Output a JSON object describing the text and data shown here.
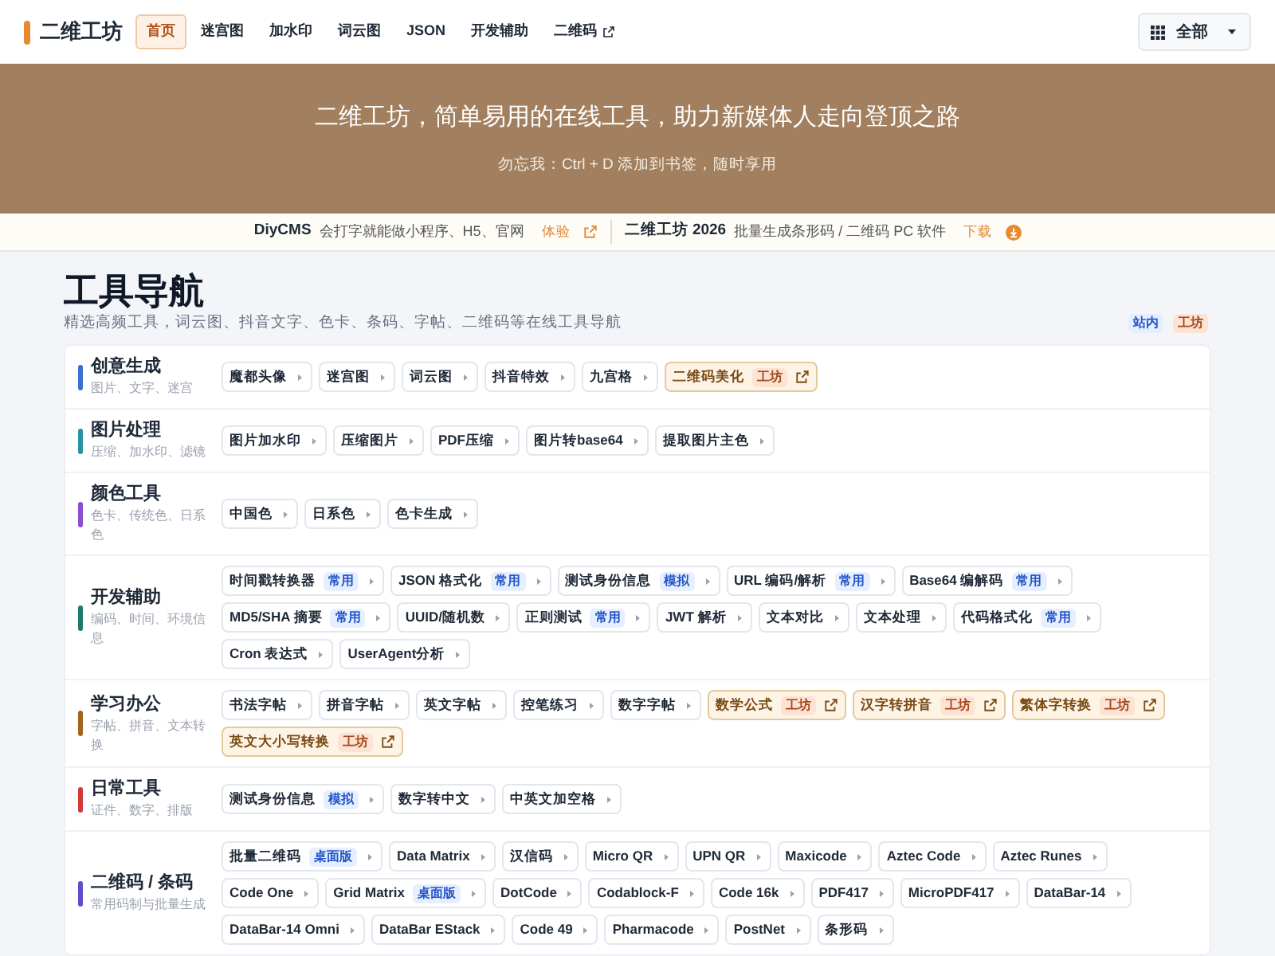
{
  "header": {
    "logo": "二维工坊",
    "nav": [
      {
        "label": "首页",
        "selected": true,
        "external": false
      },
      {
        "label": "迷宫图",
        "selected": false,
        "external": false
      },
      {
        "label": "加水印",
        "selected": false,
        "external": false
      },
      {
        "label": "词云图",
        "selected": false,
        "external": false
      },
      {
        "label": "JSON",
        "selected": false,
        "external": false
      },
      {
        "label": "开发辅助",
        "selected": false,
        "external": false
      },
      {
        "label": "二维码",
        "selected": false,
        "external": true
      }
    ],
    "menu": "全部"
  },
  "banner": {
    "title": "二维工坊，简单易用的在线工具，助力新媒体人走向登顶之路",
    "subtitle": "勿忘我：Ctrl + D 添加到书签，随时享用"
  },
  "promos": [
    {
      "name": "DiyCMS",
      "text": "会打字就能做小程序、H5、官网",
      "action": "体验",
      "kind": "external"
    },
    {
      "name": "二维工坊 2026",
      "text": "批量生成条形码 / 二维码 PC 软件",
      "action": "下载",
      "kind": "download"
    }
  ],
  "page": {
    "title": "工具导航",
    "subtitle": "精选高频工具，词云图、抖音文字、色卡、条码、字帖、二维码等在线工具导航",
    "legend": [
      {
        "text": "站内",
        "kind": "tag"
      },
      {
        "text": "工坊",
        "kind": "workshop"
      }
    ]
  },
  "sections": [
    {
      "title": "创意生成",
      "subtitle": "图片、文字、迷宫",
      "color": "#3b6fd4",
      "tools": [
        {
          "label": "魔都头像",
          "external": false
        },
        {
          "label": "迷宫图",
          "external": false
        },
        {
          "label": "词云图",
          "external": false
        },
        {
          "label": "抖音特效",
          "external": false
        },
        {
          "label": "九宫格",
          "external": false
        },
        {
          "label": "二维码美化",
          "external": true,
          "badge": {
            "text": "工坊",
            "kind": "workshop"
          }
        }
      ]
    },
    {
      "title": "图片处理",
      "subtitle": "压缩、加水印、滤镜",
      "color": "#2a93a3",
      "tools": [
        {
          "label": "图片加水印",
          "external": false
        },
        {
          "label": "压缩图片",
          "external": false
        },
        {
          "label": "PDF压缩",
          "external": false
        },
        {
          "label": "图片转base64",
          "external": false
        },
        {
          "label": "提取图片主色",
          "external": false
        }
      ]
    },
    {
      "title": "颜色工具",
      "subtitle": "色卡、传统色、日系色",
      "color": "#8b4fd6",
      "tools": [
        {
          "label": "中国色",
          "external": false
        },
        {
          "label": "日系色",
          "external": false
        },
        {
          "label": "色卡生成",
          "external": false
        }
      ]
    },
    {
      "title": "开发辅助",
      "subtitle": "编码、时间、环境信息",
      "color": "#1f7a6a",
      "tools": [
        {
          "label": "时间戳转换器",
          "external": false,
          "badge": {
            "text": "常用",
            "kind": "tag"
          }
        },
        {
          "label": "JSON 格式化",
          "external": false,
          "badge": {
            "text": "常用",
            "kind": "tag"
          }
        },
        {
          "label": "测试身份信息",
          "external": false,
          "badge": {
            "text": "模拟",
            "kind": "tag"
          }
        },
        {
          "label": "URL 编码/解析",
          "external": false,
          "badge": {
            "text": "常用",
            "kind": "tag"
          }
        },
        {
          "label": "Base64 编解码",
          "external": false,
          "badge": {
            "text": "常用",
            "kind": "tag"
          }
        },
        {
          "label": "MD5/SHA 摘要",
          "external": false,
          "badge": {
            "text": "常用",
            "kind": "tag"
          }
        },
        {
          "label": "UUID/随机数",
          "external": false
        },
        {
          "label": "正则测试",
          "external": false,
          "badge": {
            "text": "常用",
            "kind": "tag"
          }
        },
        {
          "label": "JWT 解析",
          "external": false
        },
        {
          "label": "文本对比",
          "external": false
        },
        {
          "label": "文本处理",
          "external": false
        },
        {
          "label": "代码格式化",
          "external": false,
          "badge": {
            "text": "常用",
            "kind": "tag"
          }
        },
        {
          "label": "Cron 表达式",
          "external": false
        },
        {
          "label": "UserAgent分析",
          "external": false
        }
      ]
    },
    {
      "title": "学习办公",
      "subtitle": "字帖、拼音、文本转换",
      "color": "#a8621f",
      "tools": [
        {
          "label": "书法字帖",
          "external": false
        },
        {
          "label": "拼音字帖",
          "external": false
        },
        {
          "label": "英文字帖",
          "external": false
        },
        {
          "label": "控笔练习",
          "external": false
        },
        {
          "label": "数字字帖",
          "external": false
        },
        {
          "label": "数学公式",
          "external": true,
          "badge": {
            "text": "工坊",
            "kind": "workshop"
          }
        },
        {
          "label": "汉字转拼音",
          "external": true,
          "badge": {
            "text": "工坊",
            "kind": "workshop"
          }
        },
        {
          "label": "繁体字转换",
          "external": true,
          "badge": {
            "text": "工坊",
            "kind": "workshop"
          }
        },
        {
          "label": "英文大小写转换",
          "external": true,
          "badge": {
            "text": "工坊",
            "kind": "workshop"
          }
        }
      ]
    },
    {
      "title": "日常工具",
      "subtitle": "证件、数字、排版",
      "color": "#d23a3a",
      "tools": [
        {
          "label": "测试身份信息",
          "external": false,
          "badge": {
            "text": "模拟",
            "kind": "tag"
          }
        },
        {
          "label": "数字转中文",
          "external": false
        },
        {
          "label": "中英文加空格",
          "external": false
        }
      ]
    },
    {
      "title": "二维码 / 条码",
      "subtitle": "常用码制与批量生成",
      "color": "#5b4fd0",
      "tools": [
        {
          "label": "批量二维码",
          "external": false,
          "badge": {
            "text": "桌面版",
            "kind": "tag"
          }
        },
        {
          "label": "Data Matrix",
          "external": false
        },
        {
          "label": "汉信码",
          "external": false
        },
        {
          "label": "Micro QR",
          "external": false
        },
        {
          "label": "UPN QR",
          "external": false
        },
        {
          "label": "Maxicode",
          "external": false
        },
        {
          "label": "Aztec Code",
          "external": false
        },
        {
          "label": "Aztec Runes",
          "external": false
        },
        {
          "label": "Code One",
          "external": false
        },
        {
          "label": "Grid Matrix",
          "external": false,
          "badge": {
            "text": "桌面版",
            "kind": "tag"
          }
        },
        {
          "label": "DotCode",
          "external": false
        },
        {
          "label": "Codablock-F",
          "external": false
        },
        {
          "label": "Code 16k",
          "external": false
        },
        {
          "label": "PDF417",
          "external": false
        },
        {
          "label": "MicroPDF417",
          "external": false
        },
        {
          "label": "DataBar-14",
          "external": false
        },
        {
          "label": "DataBar-14 Omni",
          "external": false
        },
        {
          "label": "DataBar EStack",
          "external": false
        },
        {
          "label": "Code 49",
          "external": false
        },
        {
          "label": "Pharmacode",
          "external": false
        },
        {
          "label": "PostNet",
          "external": false
        },
        {
          "label": "条形码",
          "external": false
        }
      ]
    }
  ]
}
